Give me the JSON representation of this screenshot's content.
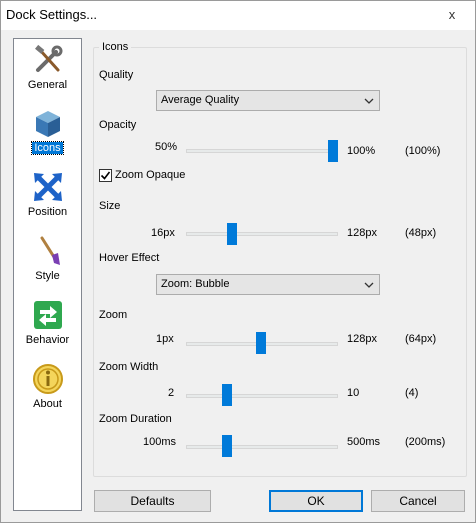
{
  "window": {
    "title": "Dock Settings...",
    "close_glyph": "x"
  },
  "sidebar": {
    "items": [
      {
        "label": "General",
        "icon": "tools-icon",
        "selected": false
      },
      {
        "label": "Icons",
        "icon": "box-icon",
        "selected": true
      },
      {
        "label": "Position",
        "icon": "move-arrows-icon",
        "selected": false
      },
      {
        "label": "Style",
        "icon": "paintbrush-icon",
        "selected": false
      },
      {
        "label": "Behavior",
        "icon": "swap-arrows-icon",
        "selected": false
      },
      {
        "label": "About",
        "icon": "info-icon",
        "selected": false
      }
    ]
  },
  "icons_group": {
    "title": "Icons",
    "quality": {
      "label": "Quality",
      "selected": "Average Quality"
    },
    "opacity": {
      "label": "Opacity",
      "min": "50%",
      "max": "100%",
      "current": "(100%)",
      "fraction": 1.0
    },
    "zoom_opaque": {
      "label": "Zoom Opaque",
      "checked": true
    },
    "size": {
      "label": "Size",
      "min": "16px",
      "max": "128px",
      "current": "(48px)",
      "fraction": 0.286
    },
    "hover_effect": {
      "label": "Hover Effect",
      "selected": "Zoom: Bubble"
    },
    "zoom": {
      "label": "Zoom",
      "min": "1px",
      "max": "128px",
      "current": "(64px)",
      "fraction": 0.496
    },
    "zoom_width": {
      "label": "Zoom Width",
      "min": "2",
      "max": "10",
      "current": "(4)",
      "fraction": 0.25
    },
    "zoom_duration": {
      "label": "Zoom Duration",
      "min": "100ms",
      "max": "500ms",
      "current": "(200ms)",
      "fraction": 0.25
    }
  },
  "buttons": {
    "defaults": "Defaults",
    "ok": "OK",
    "cancel": "Cancel"
  },
  "colors": {
    "accent": "#0078d7",
    "thumb": "#007ad9",
    "window_bg": "#f0f0f0"
  }
}
